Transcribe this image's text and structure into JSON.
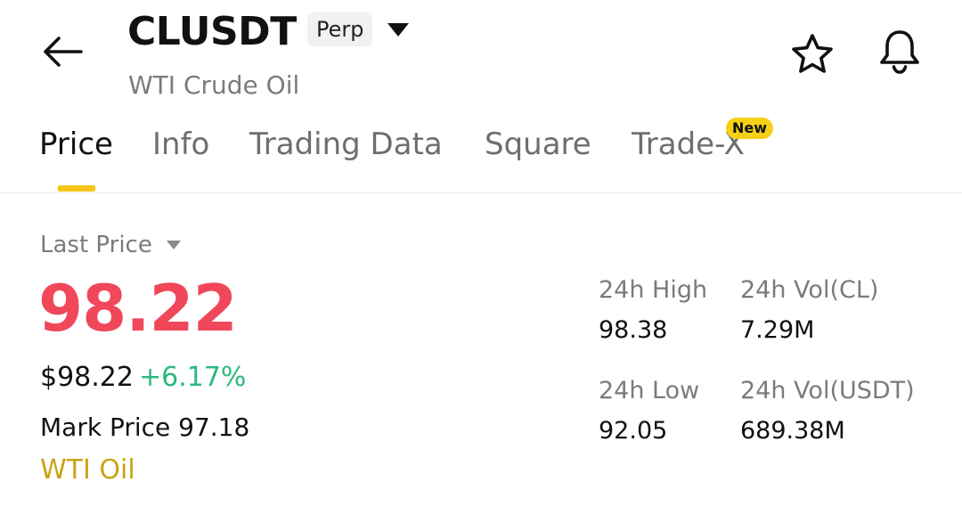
{
  "header": {
    "symbol": "CLUSDT",
    "contract_type": "Perp",
    "subtitle": "WTI Crude Oil",
    "icons": {
      "back": "arrow-left-icon",
      "dropdown": "caret-down-icon",
      "favorite": "star-icon",
      "alerts": "bell-icon"
    }
  },
  "tabs": [
    {
      "label": "Price",
      "active": true
    },
    {
      "label": "Info",
      "active": false
    },
    {
      "label": "Trading Data",
      "active": false
    },
    {
      "label": "Square",
      "active": false
    },
    {
      "label": "Trade-X",
      "active": false,
      "badge": "New"
    }
  ],
  "price": {
    "last_price_label": "Last Price",
    "last_price": "98.22",
    "usd_price": "$98.22",
    "change_percent": "+6.17%",
    "mark_price_label": "Mark Price",
    "mark_price": "97.18",
    "tag": "WTI Oil"
  },
  "stats": {
    "high_label": "24h High",
    "high_value": "98.38",
    "vol_base_label": "24h Vol(CL)",
    "vol_base_value": "7.29M",
    "low_label": "24h Low",
    "low_value": "92.05",
    "vol_quote_label": "24h Vol(USDT)",
    "vol_quote_value": "689.38M"
  },
  "colors": {
    "price_down_red": "#f0475a",
    "change_green": "#2db87f",
    "accent_yellow": "#f5c518",
    "tag_gold": "#c9a417"
  }
}
